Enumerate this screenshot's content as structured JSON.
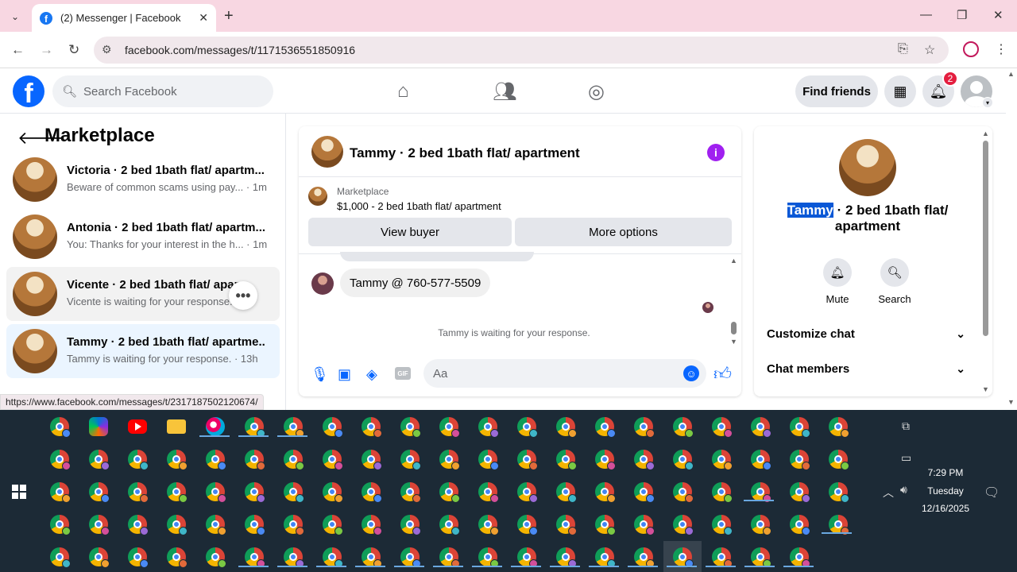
{
  "browser": {
    "tab_title": "(2) Messenger | Facebook",
    "url": "facebook.com/messages/t/1171536551850916",
    "status_url": "https://www.facebook.com/messages/t/2317187502120674/"
  },
  "header": {
    "search_placeholder": "Search Facebook",
    "find_friends": "Find friends",
    "notification_count": "2"
  },
  "sidebar": {
    "title": "Marketplace",
    "conversations": [
      {
        "name": "Victoria · 2 bed 1bath flat/ apartm...",
        "snippet": "Beware of common scams using pay... · 1m"
      },
      {
        "name": "Antonia · 2 bed 1bath flat/ apartm...",
        "snippet": "You: Thanks for your interest in the h... · 1m"
      },
      {
        "name": "Vicente · 2 bed 1bath flat/ apar...",
        "snippet": "Vicente is waiting for your response."
      },
      {
        "name": "Tammy · 2 bed 1bath flat/ apartme...",
        "snippet": "Tammy is waiting for your response. · 13h"
      }
    ]
  },
  "chat": {
    "title": "Tammy · 2 bed 1bath flat/ apartment",
    "marketplace_label": "Marketplace",
    "listing": "$1,000 - 2 bed 1bath flat/ apartment",
    "view_buyer": "View buyer",
    "more_options": "More options",
    "message": "Tammy @ 760-577-5509",
    "waiting": "Tammy is waiting for your response.",
    "input_placeholder": "Aa",
    "gif_label": "GIF"
  },
  "details": {
    "name_highlight": "Tammy",
    "title_rest": " · 2 bed 1bath flat/ apartment",
    "mute": "Mute",
    "search": "Search",
    "customize_chat": "Customize chat",
    "chat_members": "Chat members"
  },
  "taskbar": {
    "time": "7:29 PM",
    "day": "Tuesday",
    "date": "12/16/2025"
  }
}
